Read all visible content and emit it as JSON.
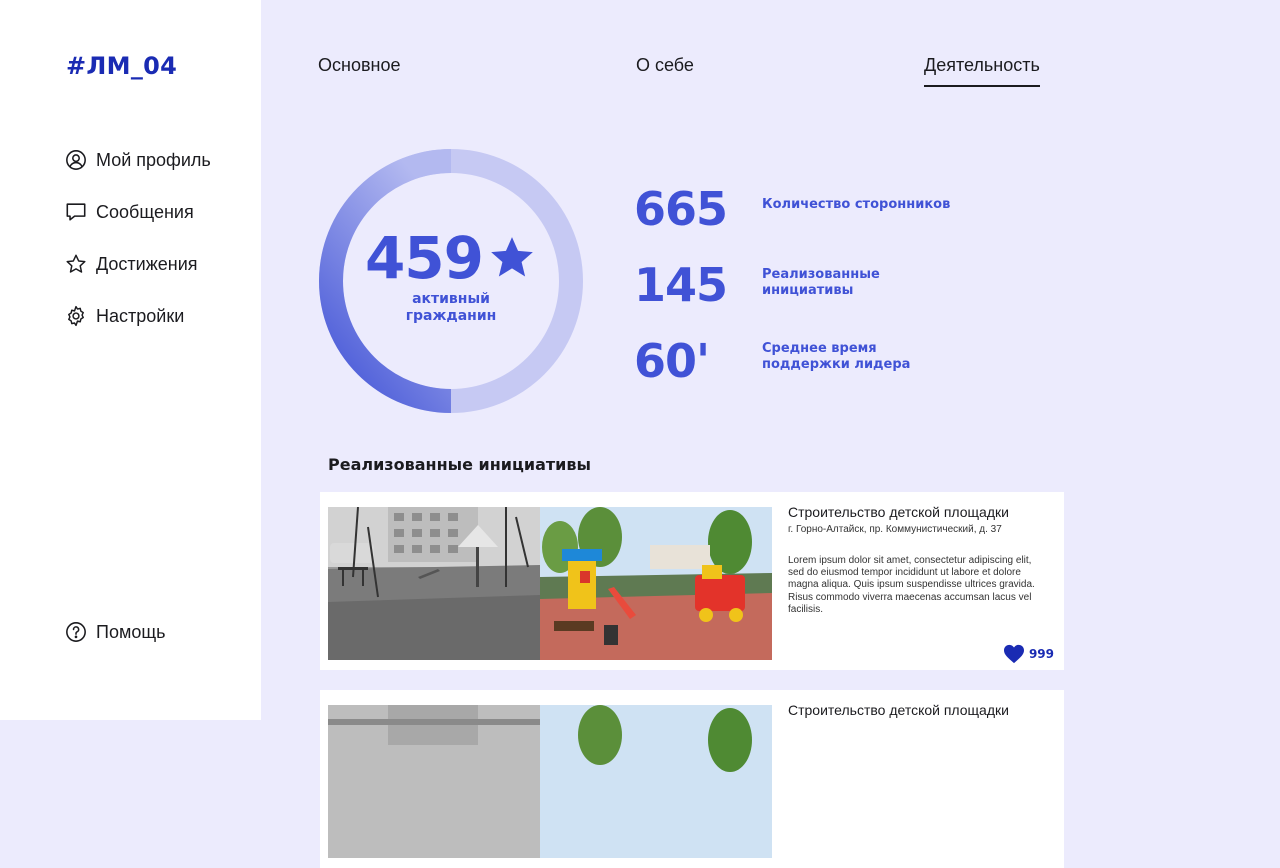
{
  "brand": {
    "logo": "#ЛМ_04",
    "accent": "#1a2bb3",
    "primary": "#4052d6"
  },
  "sidebar": {
    "items": [
      {
        "label": "Мой профиль",
        "icon": "user-circle-icon"
      },
      {
        "label": "Сообщения",
        "icon": "message-icon"
      },
      {
        "label": "Достижения",
        "icon": "star-outline-icon"
      },
      {
        "label": "Настройки",
        "icon": "gear-icon"
      }
    ],
    "help": {
      "label": "Помощь",
      "icon": "question-circle-icon"
    }
  },
  "tabs": [
    {
      "label": "Основное",
      "active": false
    },
    {
      "label": "О себе",
      "active": false
    },
    {
      "label": "Деятельность",
      "active": true
    }
  ],
  "rating": {
    "score": "459",
    "label": "активный гражданин",
    "progress": 0.5,
    "icon": "star-icon"
  },
  "stats": [
    {
      "value": "665",
      "label": "Количество сторонников"
    },
    {
      "value": "145",
      "label": "Реализованные инициативы"
    },
    {
      "value": "60'",
      "label": "Среднее время поддержки лидера"
    }
  ],
  "initiatives": {
    "title": "Реализованные инициативы",
    "items": [
      {
        "title": "Строительство детской площадки",
        "address": "г. Горно-Алтайск, пр. Коммунистический, д. 37",
        "description": "Lorem ipsum dolor sit amet, consectetur adipiscing elit, sed do eiusmod tempor incididunt ut labore et dolore magna aliqua. Quis ipsum suspendisse ultrices gravida. Risus commodo viverra maecenas accumsan lacus vel facilisis.",
        "likes": "999"
      },
      {
        "title": "Строительство детской площадки",
        "address": "",
        "description": "",
        "likes": ""
      }
    ]
  }
}
